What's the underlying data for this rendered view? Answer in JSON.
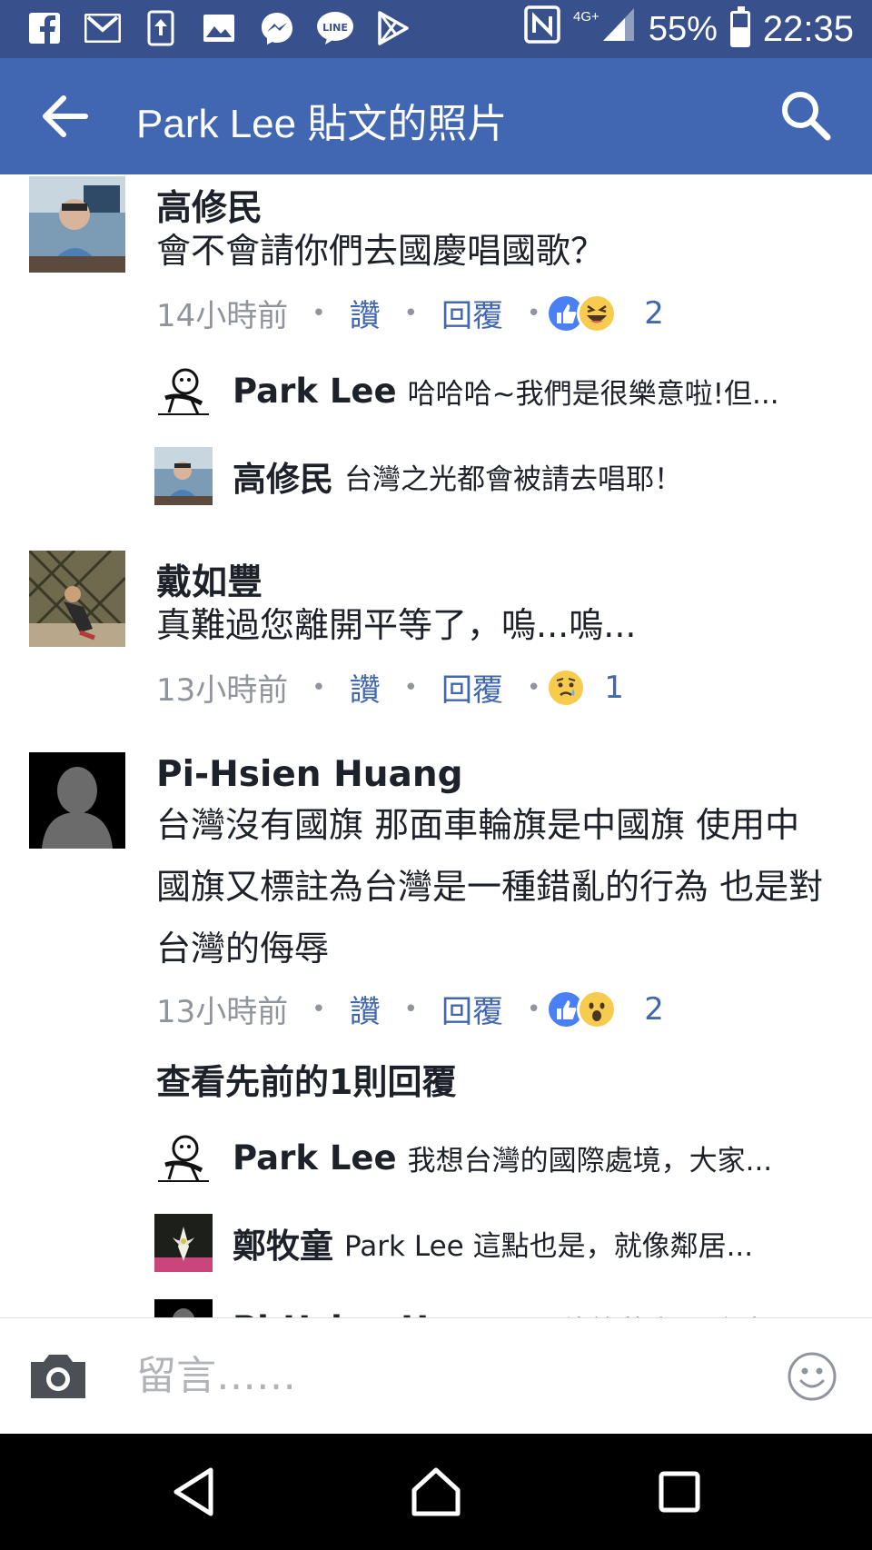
{
  "status_bar": {
    "battery_percent": "55%",
    "time": "22:35",
    "network": "4G+",
    "battery_level": 0.55,
    "icons": [
      "facebook-icon",
      "gmail-icon",
      "upload-icon",
      "gallery-icon",
      "messenger-icon",
      "line-icon",
      "play-store-icon",
      "nfc-icon",
      "signal-icon",
      "battery-icon"
    ]
  },
  "app_bar": {
    "title": "Park Lee 貼文的照片",
    "back_icon": "arrow-left-icon",
    "search_icon": "search-icon",
    "color": "#4267b2"
  },
  "comments": [
    {
      "author": "高修民",
      "text": "會不會請你們去國慶唱國歌？",
      "time": "14小時前",
      "like_label": "讚",
      "reply_label": "回覆",
      "reactions": [
        "like",
        "haha"
      ],
      "reaction_count": "2",
      "replies": [
        {
          "author": "Park Lee",
          "text": "哈哈哈~我們是很樂意啦!但..."
        },
        {
          "author": "高修民",
          "text": "台灣之光都會被請去唱耶！"
        }
      ]
    },
    {
      "author": "戴如豐",
      "text": "真難過您離開平等了，嗚...嗚...",
      "time": "13小時前",
      "like_label": "讚",
      "reply_label": "回覆",
      "reactions": [
        "sad"
      ],
      "reaction_count": "1"
    },
    {
      "author": "Pi-Hsien Huang",
      "text": "台灣沒有國旗  那面車輪旗是中國旗  使用中國旗又標註為台灣是一種錯亂的行為  也是對台灣的侮辱",
      "time": "13小時前",
      "like_label": "讚",
      "reply_label": "回覆",
      "reactions": [
        "like",
        "wow"
      ],
      "reaction_count": "2",
      "view_previous": "查看先前的1則回覆",
      "replies": [
        {
          "author": "Park Lee",
          "text": "我想台灣的國際處境，大家..."
        },
        {
          "author": "鄭牧童",
          "text": "Park Lee 這點也是，就像鄰居..."
        },
        {
          "author": "Pi-Hsien Huang",
          "text": "不能算苛求  畢竟真..."
        }
      ]
    }
  ],
  "composer": {
    "placeholder": "留言……",
    "camera_icon": "camera-icon",
    "emoji_icon": "emoji-icon"
  },
  "nav_bar": {
    "buttons": [
      "back-triangle-icon",
      "home-icon",
      "recents-icon"
    ]
  }
}
